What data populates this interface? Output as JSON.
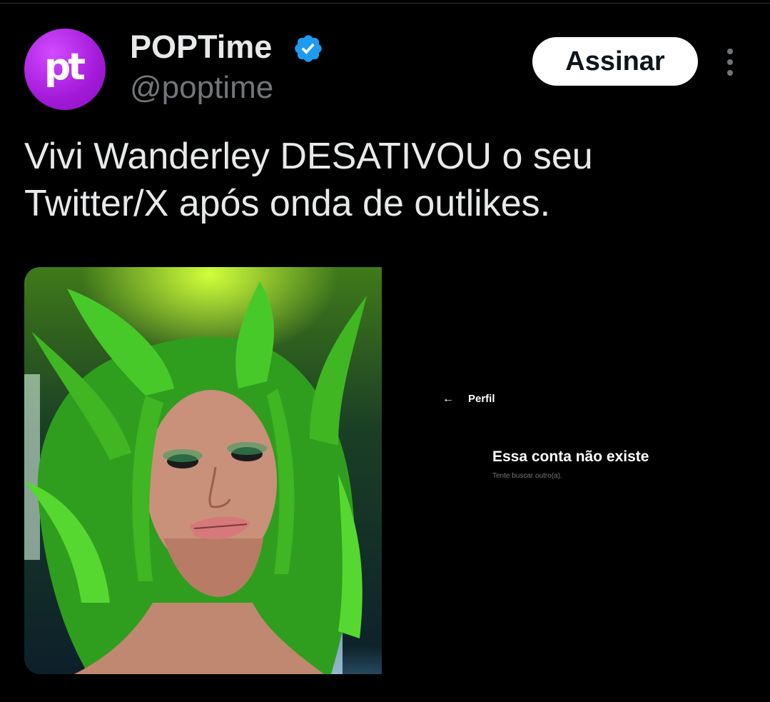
{
  "tweet": {
    "author": {
      "avatar_text": "pt",
      "name": "POPTime",
      "handle": "@poptime",
      "verified": true
    },
    "subscribe_label": "Assinar",
    "text": "Vivi Wanderley DESATIVOU o seu Twitter/X após onda de outlikes.",
    "media": {
      "profile_screenshot": {
        "header_label": "Perfil",
        "empty_title": "Essa conta não existe",
        "empty_subtitle": "Tente buscar outro(a)."
      }
    }
  },
  "colors": {
    "background": "#000000",
    "text_primary": "#e7e9ea",
    "text_secondary": "#71767b",
    "verified_blue": "#1d9bf0",
    "avatar_purple": "#a21ad8",
    "hair_green": "#3fcf2a"
  },
  "icons": {
    "verified": "verified-badge-icon",
    "more": "more-vertical-icon",
    "back": "back-arrow-icon"
  }
}
